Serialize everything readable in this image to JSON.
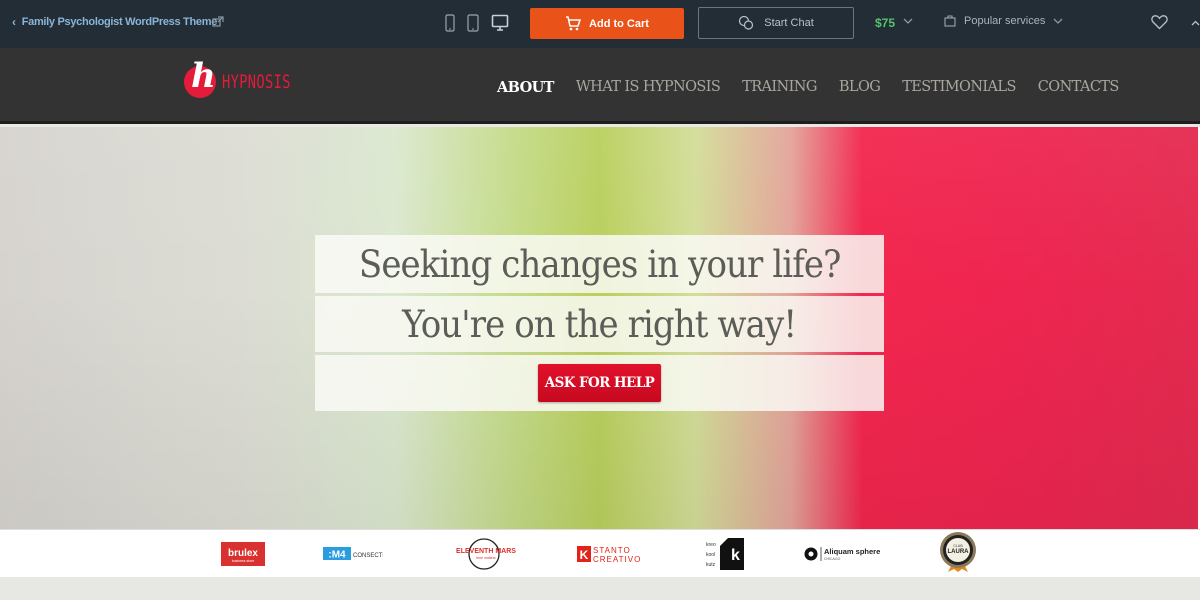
{
  "topbar": {
    "theme_title": "Family Psychologist WordPress Theme",
    "back_icon": "chevron-left-icon",
    "external_icon": "external-link-icon",
    "devices": [
      "mobile-icon",
      "tablet-icon",
      "desktop-icon"
    ],
    "add_to_cart_label": "Add to Cart",
    "start_chat_label": "Start Chat",
    "price": "$75",
    "popular_services_label": "Popular services",
    "accent_color": "#e9531a",
    "price_color": "#55c26a"
  },
  "site": {
    "logo_letter": "h",
    "logo_text": "HYPNOSIS",
    "brand_color": "#e41b3a",
    "nav": [
      {
        "label": "ABOUT",
        "active": true
      },
      {
        "label": "WHAT IS HYPNOSIS",
        "active": false
      },
      {
        "label": "TRAINING",
        "active": false
      },
      {
        "label": "BLOG",
        "active": false
      },
      {
        "label": "TESTIMONIALS",
        "active": false
      },
      {
        "label": "CONTACTS",
        "active": false
      }
    ]
  },
  "hero": {
    "line1": "Seeking changes in your life?",
    "line2": "You're on the right way!",
    "cta_label": "ASK FOR HELP"
  },
  "partners": [
    {
      "name": "brulex",
      "sub": "business store"
    },
    {
      "name": "M4",
      "sub": "CONSECTETUR"
    },
    {
      "name": "ELEVENTH MARS",
      "sub": "time matters"
    },
    {
      "name": "STANTO",
      "sub": "CREATIVO"
    },
    {
      "name": "kreo kool kutz",
      "sub": "K"
    },
    {
      "name": "Aliquam sphere",
      "sub": "CHICAGO"
    },
    {
      "name": "CLUB LAURA",
      "sub": "badge"
    }
  ]
}
